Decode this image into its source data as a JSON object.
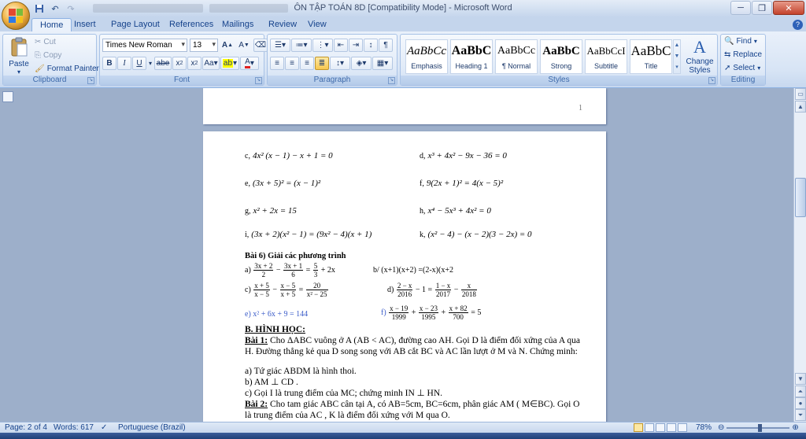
{
  "window": {
    "title": "ÔN TẬP TOÁN 8D [Compatibility Mode] - Microsoft Word"
  },
  "tabs": [
    "Home",
    "Insert",
    "Page Layout",
    "References",
    "Mailings",
    "Review",
    "View"
  ],
  "clipboard": {
    "paste": "Paste",
    "cut": "Cut",
    "copy": "Copy",
    "format_painter": "Format Painter",
    "label": "Clipboard"
  },
  "font": {
    "family": "Times New Roman",
    "size": "13",
    "label": "Font"
  },
  "paragraph": {
    "label": "Paragraph"
  },
  "styles": {
    "label": "Styles",
    "items": [
      {
        "sample": "AaBbCc",
        "name": "Emphasis"
      },
      {
        "sample": "AaBbC",
        "name": "Heading 1"
      },
      {
        "sample": "AaBbCc",
        "name": "¶ Normal"
      },
      {
        "sample": "AaBbC",
        "name": "Strong"
      },
      {
        "sample": "AaBbCcI",
        "name": "Subtitle"
      },
      {
        "sample": "AaBbC",
        "name": "Title"
      }
    ],
    "change_styles": "Change Styles"
  },
  "editing": {
    "find": "Find",
    "replace": "Replace",
    "select": "Select",
    "label": "Editing"
  },
  "document": {
    "prev_page_number": "1",
    "equations": {
      "c_label": "c,",
      "c": "4x² (x − 1) − x + 1 = 0",
      "d_label": "d,",
      "d": "x³ + 4x² − 9x − 36 = 0",
      "e_label": "e,",
      "e": "(3x + 5)² = (x − 1)²",
      "f_label": "f,",
      "f": "9(2x + 1)² = 4(x − 5)²",
      "g_label": "g,",
      "g": "x² + 2x = 15",
      "h_label": "h,",
      "h": "x⁴ − 5x³ + 4x² = 0",
      "i_label": "i,",
      "i": "(3x + 2)(x² − 1) = (9x² − 4)(x + 1)",
      "k_label": "k,",
      "k": "(x² − 4) − (x − 2)(3 − 2x) = 0"
    },
    "bai6": {
      "title": "Bài 6)  Giải các phương trình",
      "a_label": "a)",
      "b_text": "b/ (x+1)(x+2) =(2-x)(x+2",
      "c_label": "c)",
      "d_label": "d)",
      "e_text": "e)  x² + 6x + 9 = 144",
      "f_label": "f)",
      "a_parts": [
        "3x + 2",
        "2",
        "−",
        "3x + 1",
        "6",
        "=",
        "5",
        "3",
        "+ 2x"
      ],
      "c_parts": [
        "x + 5",
        "x − 5",
        "−",
        "x − 5",
        "x + 5",
        "=",
        "20",
        "x² − 25"
      ],
      "d_parts": [
        "2 − x",
        "2016",
        "− 1 =",
        "1 − x",
        "2017",
        "−",
        "x",
        "2018"
      ],
      "f_parts": [
        "x − 19",
        "1999",
        "+",
        "x − 23",
        "1995",
        "+",
        "x + 82",
        "700",
        "= 5"
      ]
    },
    "geometry": {
      "heading": "B. HÌNH HỌC:",
      "bai1_label": "Bài 1:",
      "bai1_text": " Cho  ΔABC vuông ở A (AB < AC), đường cao AH. Gọi D là điểm đối xứng của A qua H. Đường thẳng kẻ qua D song song với AB cắt BC và AC lần lượt ở M và N. Chứng minh:",
      "items": [
        "a) Tứ giác ABDM là hình thoi.",
        "b) AM   ⊥ CD .",
        "c) Gọi I là trung điểm của MC; chứng minh IN  ⊥  HN."
      ],
      "bai2_label": "Bài 2:",
      "bai2_text": " Cho tam giác ABC cân tại A, có AB=5cm, BC=6cm, phân giác AM ( M∈BC). Gọi O là trung điểm của AC , K là điểm đối xứng với M qua O."
    }
  },
  "status": {
    "page": "Page: 2 of 4",
    "words": "Words: 617",
    "language": "Portuguese (Brazil)",
    "zoom": "78%"
  }
}
